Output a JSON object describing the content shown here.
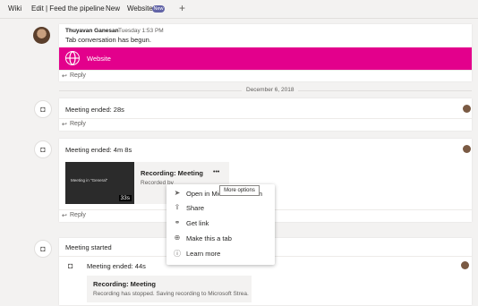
{
  "tabs": {
    "wiki": "Wiki",
    "edit_feed": "Edit | Feed the pipeline",
    "new": "New",
    "website": "Website",
    "website_badge": "New",
    "add": "+"
  },
  "post": {
    "author": "Thuyavan Ganesan",
    "time": "Tuesday 1:53 PM",
    "text": "Tab conversation has begun.",
    "banner_label": "Website",
    "reply": "Reply"
  },
  "date_divider": "December 6, 2018",
  "meeting1": {
    "title": "Meeting ended: 28s",
    "reply": "Reply"
  },
  "meeting2": {
    "title": "Meeting ended: 4m 8s",
    "recording_title": "Recording: Meeting",
    "recording_sub": "Recorded by",
    "thumb_title": "Meeting in \"General\"",
    "thumb_duration": "33s",
    "more": "•••",
    "reply": "Reply"
  },
  "tooltip": "More options",
  "menu": {
    "items": [
      {
        "label": "Open in Microsoft Stream",
        "icon": "arrow-icon"
      },
      {
        "label": "Share",
        "icon": "share-icon"
      },
      {
        "label": "Get link",
        "icon": "link-icon"
      },
      {
        "label": "Make this a tab",
        "icon": "tab-icon"
      },
      {
        "label": "Learn more",
        "icon": "info-icon"
      }
    ]
  },
  "meeting3": {
    "title": "Meeting started",
    "sub_title": "Meeting ended: 44s",
    "recording_title": "Recording: Meeting",
    "recording_text": "Recording has stopped. Saving recording to Microsoft Strea..."
  },
  "colors": {
    "accent": "#e3008c",
    "badge": "#6264a7"
  }
}
